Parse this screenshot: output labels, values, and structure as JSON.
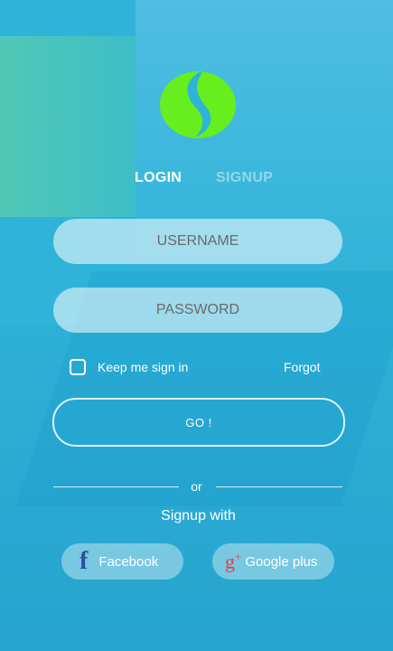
{
  "tabs": {
    "login": "LOGIN",
    "signup": "SIGNUP"
  },
  "form": {
    "username_placeholder": "USERNAME",
    "password_placeholder": "PASSWORD",
    "keep_signed_in": "Keep me sign in",
    "forgot": "Forgot",
    "go_label": "GO !"
  },
  "divider": {
    "or": "or"
  },
  "social": {
    "heading": "Signup with",
    "facebook": "Facebook",
    "google": "Google plus"
  },
  "icons": {
    "logo": "leaf-logo-icon",
    "facebook": "facebook-icon",
    "google": "google-plus-icon",
    "checkbox": "checkbox-icon"
  },
  "colors": {
    "background": "#2fb3d8",
    "logo_green": "#66ee1e",
    "facebook_blue": "#2d4f9e",
    "google_red": "#e0413a"
  }
}
